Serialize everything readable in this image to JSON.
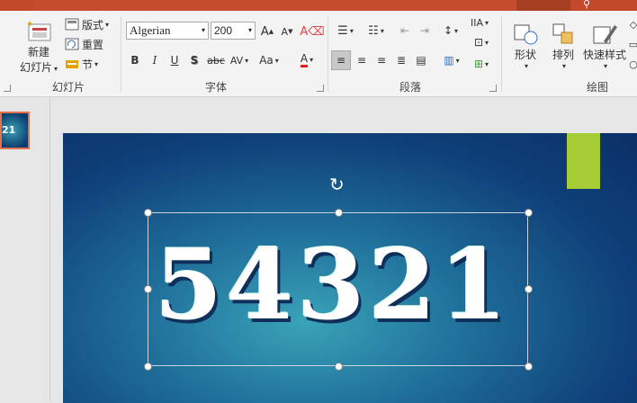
{
  "ribbon": {
    "slides_group": {
      "new_slide_label": "新建\n幻灯片",
      "new_slide_line1": "新建",
      "new_slide_line2": "幻灯片",
      "layout_label": "版式",
      "reset_label": "重置",
      "section_label": "节",
      "group_label": "幻灯片"
    },
    "font_group": {
      "font_name": "Algerian",
      "font_size": "200",
      "group_label": "字体"
    },
    "paragraph_group": {
      "group_label": "段落"
    },
    "drawing_group": {
      "shapes_label": "形状",
      "arrange_label": "排列",
      "quick_styles_label": "快速样式",
      "group_label": "绘图"
    }
  },
  "thumbnail": {
    "text": "21"
  },
  "slide": {
    "text": "54321"
  },
  "colors": {
    "titlebar": "#c2492b",
    "accent_bar": "#a5cc34",
    "thumb_border": "#e2714e"
  }
}
